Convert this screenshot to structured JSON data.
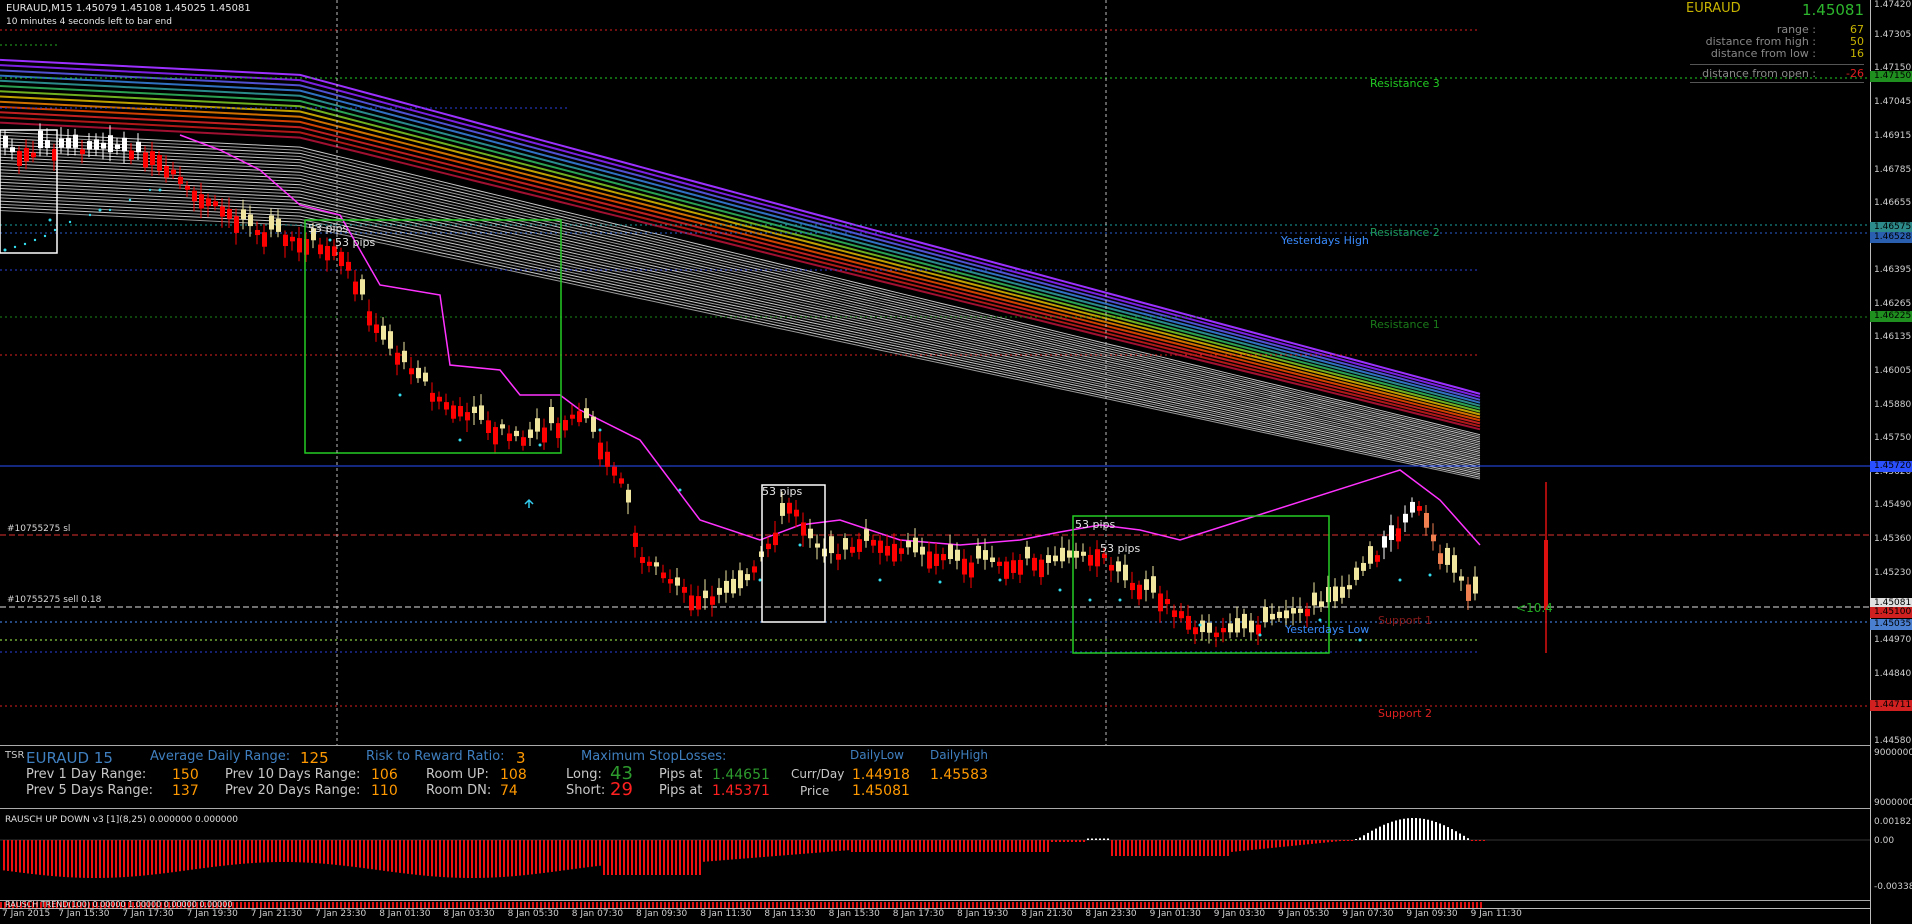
{
  "header": {
    "symbol_line": "EURAUD,M15  1.45079 1.45108 1.45025 1.45081",
    "timer": "10 minutes 4 seconds left to bar end"
  },
  "info_box": {
    "symbol": "EURAUD",
    "price": "1.45081",
    "rows": [
      {
        "label": "range :",
        "value": "67"
      },
      {
        "label": "distance from high :",
        "value": "50"
      },
      {
        "label": "distance from low :",
        "value": "16"
      },
      {
        "label": "distance from open :",
        "value": "-26"
      }
    ]
  },
  "levels": {
    "resistance3": "Resistance 3",
    "resistance2": "Resistance 2",
    "resistance1": "Resistance 1",
    "yesterdays_high": "Yesterdays High",
    "yesterdays_low": "Yesterdays Low",
    "support1": "Support 1",
    "support2": "Support 2",
    "order_sl": "#10755275 sl",
    "order_sell": "#10755275 sell 0.18",
    "pips_marker": "10.4"
  },
  "boxes": [
    {
      "label": "53 pips",
      "label2": "53 pips"
    },
    {
      "label": "53 pips"
    },
    {
      "label": "53 pips",
      "label2": "53 pips"
    }
  ],
  "price_axis": {
    "labels": [
      "1.47420",
      "1.47305",
      "1.47150",
      "1.47045",
      "1.46915",
      "1.46785",
      "1.46655",
      "1.46525",
      "1.46395",
      "1.46265",
      "1.46135",
      "1.46005",
      "1.45880",
      "1.45750",
      "1.45620",
      "1.45490",
      "1.45360",
      "1.45230",
      "1.45100",
      "1.44970",
      "1.44840",
      "1.44710",
      "1.44580"
    ],
    "badges": [
      {
        "text": "1.47150",
        "color": "#1f8f1f"
      },
      {
        "text": "1.46575",
        "color": "#2d8a8a"
      },
      {
        "text": "1.46528",
        "color": "#2a5fb0"
      },
      {
        "text": "1.46225",
        "color": "#1f8f1f"
      },
      {
        "text": "1.45720",
        "color": "#2a4fff"
      },
      {
        "text": "1.45081",
        "color": "#e0e0e0"
      },
      {
        "text": "1.45100",
        "color": "#d02020"
      },
      {
        "text": "1.45035",
        "color": "#4a7fd0"
      },
      {
        "text": "1.44711",
        "color": "#d02020"
      }
    ],
    "ind_labels": [
      "9000000",
      "9000000"
    ],
    "rausch_labels": [
      "0.00182",
      "0.00",
      "-0.00338"
    ]
  },
  "tsr": {
    "tag": "TSR",
    "symbol": "EURAUD 15",
    "adr_label": "Average Daily Range:",
    "adr_value": "125",
    "rr_label": "Risk to Reward Ratio:",
    "rr_value": "3",
    "msl_label": "Maximum StopLosses:",
    "daily_low_label": "DailyLow",
    "daily_high_label": "DailyHigh",
    "prev1_label": "Prev 1 Day Range:",
    "prev1_value": "150",
    "prev10_label": "Prev 10 Days Range:",
    "prev10_value": "106",
    "room_up_label": "Room UP:",
    "room_up_value": "108",
    "long_label": "Long:",
    "long_value": "43",
    "pips_at_label": "Pips at",
    "long_pips": "1.44651",
    "currday_label": "Curr/Day",
    "daily_low": "1.44918",
    "daily_high": "1.45583",
    "prev5_label": "Prev 5 Days Range:",
    "prev5_value": "137",
    "prev20_label": "Prev 20 Days Range:",
    "prev20_value": "110",
    "room_dn_label": "Room DN:",
    "room_dn_value": "74",
    "short_label": "Short:",
    "short_value": "29",
    "short_pips": "1.45371",
    "price_label": "Price",
    "price_value": "1.45081"
  },
  "indicators": {
    "rausch_updown": "RAUSCH UP DOWN v3 [1](8,25) 0.000000 0.000000",
    "rausch_trend": "RAUSCH TREND(100) 0.00000 1.00000 0.00000 0.00000"
  },
  "time_axis": [
    "7 Jan 2015",
    "7 Jan 15:30",
    "7 Jan 17:30",
    "7 Jan 19:30",
    "7 Jan 21:30",
    "7 Jan 23:30",
    "8 Jan 01:30",
    "8 Jan 03:30",
    "8 Jan 05:30",
    "8 Jan 07:30",
    "8 Jan 09:30",
    "8 Jan 11:30",
    "8 Jan 13:30",
    "8 Jan 15:30",
    "8 Jan 17:30",
    "8 Jan 19:30",
    "8 Jan 21:30",
    "8 Jan 23:30",
    "9 Jan 01:30",
    "9 Jan 03:30",
    "9 Jan 05:30",
    "9 Jan 07:30",
    "9 Jan 09:30",
    "9 Jan 11:30"
  ],
  "colors": {
    "background": "#000000",
    "bull_candle": "#f0e6a0",
    "bear_candle": "#ff0000",
    "box": "#22cc22",
    "resistance": "#22cc22",
    "support": "#e02020",
    "trail": "#ff33ff",
    "stop_dots": "#33ddee"
  }
}
